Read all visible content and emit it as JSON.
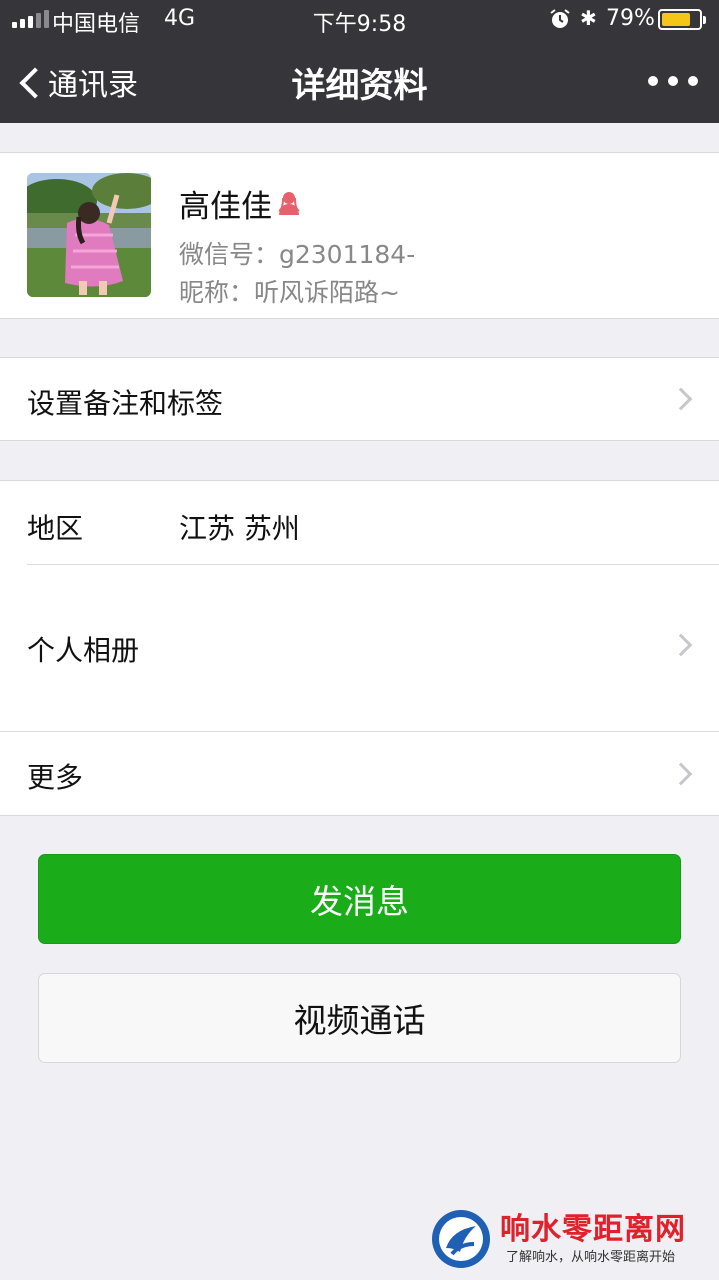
{
  "status_bar": {
    "carrier": "中国电信",
    "network": "4G",
    "time": "下午9:58",
    "battery_percent": "79%",
    "battery_level": 0.79,
    "icons": [
      "signal-icon",
      "alarm-icon",
      "bluetooth-icon",
      "battery-icon"
    ]
  },
  "nav": {
    "back_label": "通讯录",
    "title": "详细资料",
    "more_icon": "more-dots-icon"
  },
  "profile": {
    "name": "高佳佳",
    "gender_icon": "female-icon",
    "gender_color": "#e8606b",
    "wechat_id_label": "微信号：g2301184-",
    "nickname_label": "昵称：听风诉陌路~"
  },
  "remark_row": {
    "label": "设置备注和标签"
  },
  "info": {
    "region_label": "地区",
    "region_value": "江苏 苏州",
    "album_label": "个人相册",
    "more_label": "更多"
  },
  "actions": {
    "send_message": "发消息",
    "video_call": "视频通话",
    "accent_color": "#1aad19"
  },
  "watermark": {
    "title": "响水零距离网",
    "subtitle": "了解响水，从响水零距离开始"
  }
}
